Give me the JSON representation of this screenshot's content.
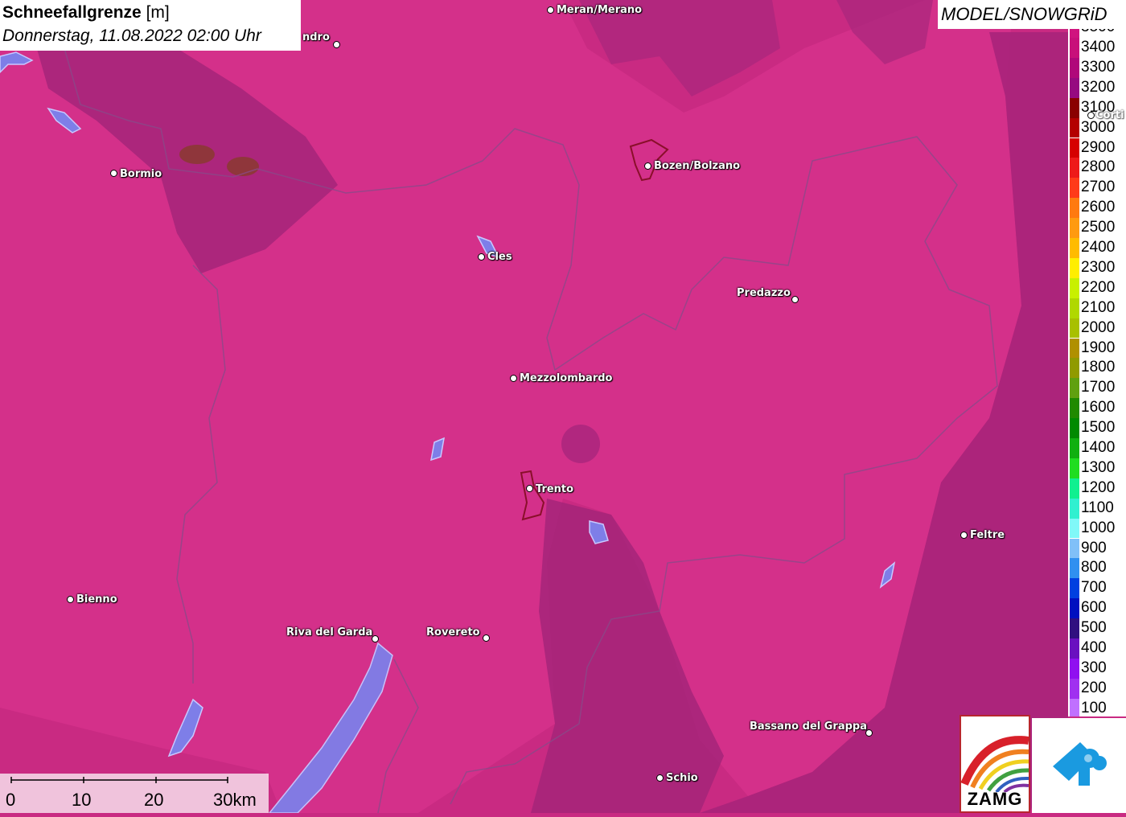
{
  "title": {
    "parameter": "Schneefallgrenze",
    "unit": "[m]",
    "datetime": "Donnerstag, 11.08.2022 02:00 Uhr"
  },
  "model": "MODEL/SNOWGRiD",
  "legend": {
    "top_partial_label": "3500",
    "levels": [
      {
        "label": "3400",
        "color": "#c8107a"
      },
      {
        "label": "3300",
        "color": "#b0087a"
      },
      {
        "label": "3200",
        "color": "#960a80"
      },
      {
        "label": "3100",
        "color": "#8a0000"
      },
      {
        "label": "3000",
        "color": "#b40000"
      },
      {
        "label": "2900",
        "color": "#d60000"
      },
      {
        "label": "2800",
        "color": "#ee1a1a"
      },
      {
        "label": "2700",
        "color": "#ff3a1a"
      },
      {
        "label": "2600",
        "color": "#ff7a10"
      },
      {
        "label": "2500",
        "color": "#ff9a10"
      },
      {
        "label": "2400",
        "color": "#ffbb00"
      },
      {
        "label": "2300",
        "color": "#ffee00"
      },
      {
        "label": "2200",
        "color": "#c8f000"
      },
      {
        "label": "2100",
        "color": "#b0d800"
      },
      {
        "label": "2000",
        "color": "#a8c000"
      },
      {
        "label": "1900",
        "color": "#b09000"
      },
      {
        "label": "1800",
        "color": "#909a00"
      },
      {
        "label": "1700",
        "color": "#60a010"
      },
      {
        "label": "1600",
        "color": "#208a00"
      },
      {
        "label": "1500",
        "color": "#008a00"
      },
      {
        "label": "1400",
        "color": "#10b010"
      },
      {
        "label": "1300",
        "color": "#20dd20"
      },
      {
        "label": "1200",
        "color": "#10f090"
      },
      {
        "label": "1100",
        "color": "#30f0d0"
      },
      {
        "label": "1000",
        "color": "#80f8f8"
      },
      {
        "label": "900",
        "color": "#80c0f8"
      },
      {
        "label": "800",
        "color": "#3090f0"
      },
      {
        "label": "700",
        "color": "#0040e0"
      },
      {
        "label": "600",
        "color": "#0010c0"
      },
      {
        "label": "500",
        "color": "#301080"
      },
      {
        "label": "400",
        "color": "#6a10c0"
      },
      {
        "label": "300",
        "color": "#9010f0"
      },
      {
        "label": "200",
        "color": "#a030f0"
      },
      {
        "label": "100",
        "color": "#c070ff"
      }
    ]
  },
  "cities": [
    {
      "name": "Meran/Merano"
    },
    {
      "name": "ndro"
    },
    {
      "name": "Bozen/Bolzano"
    },
    {
      "name": "Bormio"
    },
    {
      "name": "Cles"
    },
    {
      "name": "Predazzo"
    },
    {
      "name": "Mezzolombardo"
    },
    {
      "name": "Trento"
    },
    {
      "name": "Feltre"
    },
    {
      "name": "Bienno"
    },
    {
      "name": "Riva del Garda"
    },
    {
      "name": "Rovereto"
    },
    {
      "name": "Bassano del Grappa"
    },
    {
      "name": "Schio"
    },
    {
      "name": "Corti"
    }
  ],
  "scale": {
    "labels": [
      "0",
      "10",
      "20",
      "30km"
    ]
  },
  "logos": {
    "zamg": "ZAMG",
    "zamg_icon": "rainbow-icon",
    "snowgrid_icon": "cloud-drop-icon"
  },
  "colors": {
    "map_base": "#c92a82",
    "map_light": "#d0308a",
    "map_dark_band": "#a01e73",
    "lake": "#7e7ee8",
    "border_line": "#7a5a80"
  }
}
